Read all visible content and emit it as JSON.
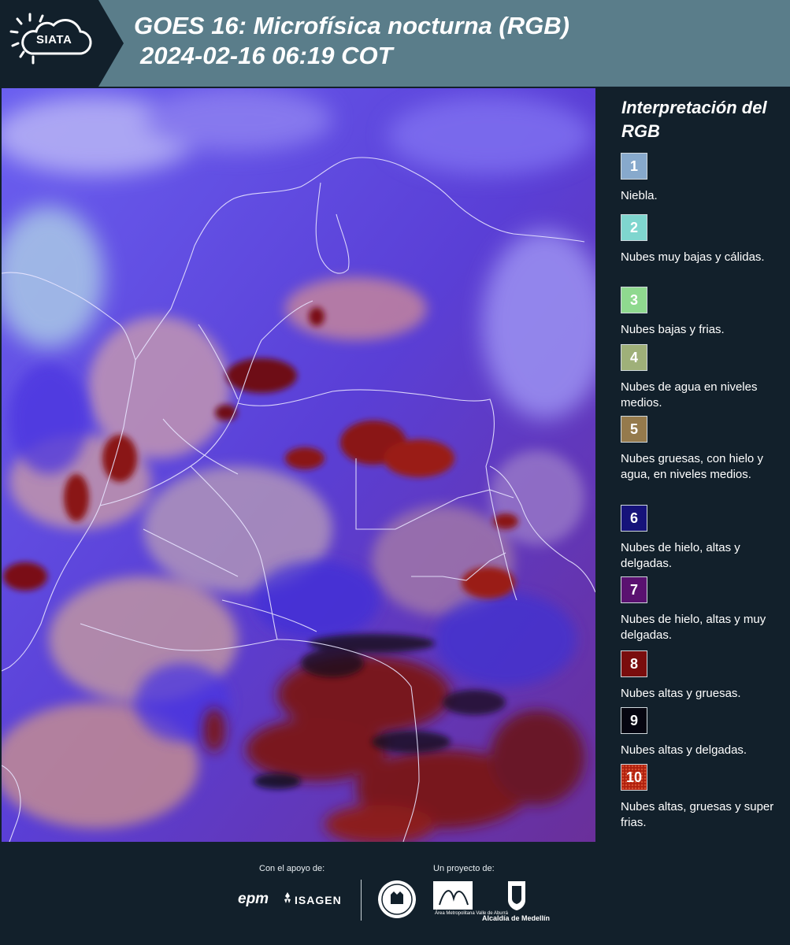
{
  "header": {
    "logo_text": "SIATA",
    "title": "GOES 16: Microfísica nocturna (RGB)",
    "subtitle": "2024-02-16 06:19 COT"
  },
  "legend": {
    "title": "Interpretación del RGB",
    "items": [
      {
        "number": "1",
        "label": "Niebla.",
        "color": "#87a9cc"
      },
      {
        "number": "2",
        "label": "Nubes muy bajas y cálidas.",
        "color": "#7fd6cf"
      },
      {
        "number": "3",
        "label": "Nubes bajas y frias.",
        "color": "#8fd98f"
      },
      {
        "number": "4",
        "label": "Nubes de agua en niveles medios.",
        "color": "#9fb079"
      },
      {
        "number": "5",
        "label": "Nubes gruesas, con hielo y agua, en niveles medios.",
        "color": "#957a4c"
      },
      {
        "number": "6",
        "label": "Nubes de hielo, altas y delgadas.",
        "color": "#16137a"
      },
      {
        "number": "7",
        "label": "Nubes de hielo, altas y muy delgadas.",
        "color": "#5a1170"
      },
      {
        "number": "8",
        "label": "Nubes altas y gruesas.",
        "color": "#7a0d0d"
      },
      {
        "number": "9",
        "label": "Nubes altas y delgadas.",
        "color": "#050510"
      },
      {
        "number": "10",
        "label": "Nubes altas, gruesas y super frias.",
        "color": "#b0200e"
      }
    ]
  },
  "footer": {
    "support_label": "Con el apoyo de:",
    "project_label": "Un proyecto de:",
    "sponsor_1": "epm",
    "sponsor_2": "ISAGEN",
    "partner_1": "Área Metropolitana Valle de Aburrá",
    "partner_2": "Alcaldía de Medellín"
  }
}
